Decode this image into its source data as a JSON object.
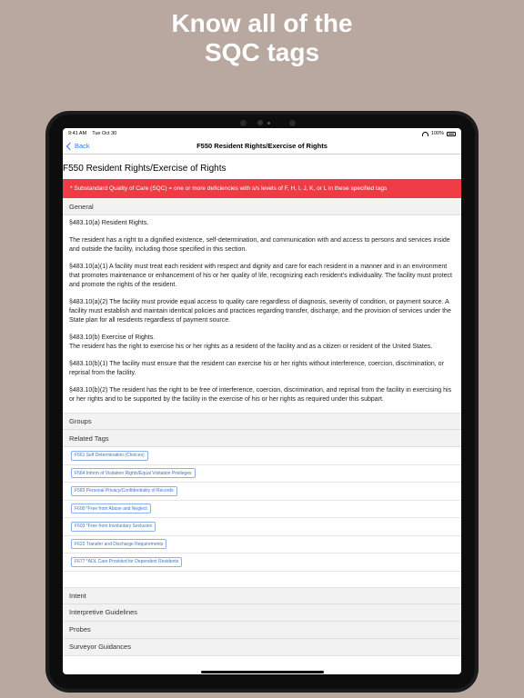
{
  "headline": {
    "line1": "Know all of the",
    "line2": "SQC tags"
  },
  "statusbar": {
    "time": "9:41 AM",
    "date": "Tue Oct 30",
    "battery": "100%"
  },
  "navbar": {
    "back_label": "Back",
    "title": "F550 Resident Rights/Exercise of Rights"
  },
  "page_title": "F550 Resident Rights/Exercise of Rights",
  "sqc_banner": "* Substandard Quality of Care (SQC) = one or more deficiencies with s/s levels of F, H, I, J, K, or L in these specified tags",
  "sections": {
    "general": "General",
    "groups": "Groups",
    "related_tags": "Related Tags",
    "intent": "Intent",
    "interpretive_guidelines": "Interpretive Guidelines",
    "probes": "Probes",
    "surveyor_guidances": "Surveyor Guidances"
  },
  "general_paragraphs": [
    "§483.10(a) Resident Rights.",
    "The resident has a right to a dignified existence, self-determination, and communication with and access to persons and services inside and outside the facility, including those specified in this section.",
    "§483.10(a)(1) A facility must treat each resident with respect and dignity and care for each resident in a manner and in an environment that promotes maintenance or enhancement of his or her quality of life, recognizing each resident's individuality. The facility must protect and promote the rights of the resident.",
    "§483.10(a)(2) The facility must provide equal access to quality care regardless of diagnosis, severity of condition, or payment source. A facility must establish and maintain identical policies and practices regarding transfer, discharge, and the provision of services under the State plan for all residents regardless of payment source.",
    "§483.10(b) Exercise of Rights.\nThe resident has the right to exercise his or her rights as a resident of the facility and as a citizen or resident of the United States.",
    "§483.10(b)(1) The facility must ensure that the resident can exercise his or her rights without interference, coercion, discrimination, or reprisal from the facility.",
    "§483.10(b)(2) The resident has the right to be free of interference, coercion, discrimination, and reprisal from the facility in exercising his or her rights and to be supported by the facility in the exercise of his or her rights as required under this subpart."
  ],
  "related_tags": [
    "F561 Self Determination (Choices)",
    "F564 Inform of Visitation Rights/Equal Visitation Privileges",
    "F583 Personal Privacy/Confidentiality of Records",
    "F600 *Free from Abuse and Neglect",
    "F603 *Free from Involuntary Seclusion",
    "F622 Transfer and Discharge Requirements",
    "F677 *ADL Care Provided for Dependent Residents"
  ],
  "colors": {
    "background": "#b8a89f",
    "accent": "#2f7cf6",
    "banner": "#ef3b46",
    "tag_border": "#8fb0ea"
  },
  "icons": [
    "back-chevron-icon",
    "wifi-icon",
    "battery-icon"
  ]
}
